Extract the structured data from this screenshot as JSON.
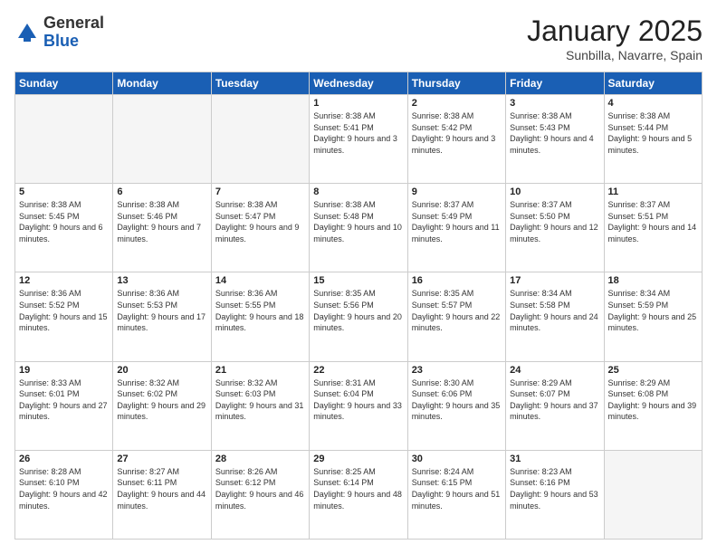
{
  "header": {
    "logo_general": "General",
    "logo_blue": "Blue",
    "title": "January 2025",
    "subtitle": "Sunbilla, Navarre, Spain"
  },
  "weekdays": [
    "Sunday",
    "Monday",
    "Tuesday",
    "Wednesday",
    "Thursday",
    "Friday",
    "Saturday"
  ],
  "weeks": [
    [
      {
        "day": "",
        "sunrise": "",
        "sunset": "",
        "daylight": ""
      },
      {
        "day": "",
        "sunrise": "",
        "sunset": "",
        "daylight": ""
      },
      {
        "day": "",
        "sunrise": "",
        "sunset": "",
        "daylight": ""
      },
      {
        "day": "1",
        "sunrise": "Sunrise: 8:38 AM",
        "sunset": "Sunset: 5:41 PM",
        "daylight": "Daylight: 9 hours and 3 minutes."
      },
      {
        "day": "2",
        "sunrise": "Sunrise: 8:38 AM",
        "sunset": "Sunset: 5:42 PM",
        "daylight": "Daylight: 9 hours and 3 minutes."
      },
      {
        "day": "3",
        "sunrise": "Sunrise: 8:38 AM",
        "sunset": "Sunset: 5:43 PM",
        "daylight": "Daylight: 9 hours and 4 minutes."
      },
      {
        "day": "4",
        "sunrise": "Sunrise: 8:38 AM",
        "sunset": "Sunset: 5:44 PM",
        "daylight": "Daylight: 9 hours and 5 minutes."
      }
    ],
    [
      {
        "day": "5",
        "sunrise": "Sunrise: 8:38 AM",
        "sunset": "Sunset: 5:45 PM",
        "daylight": "Daylight: 9 hours and 6 minutes."
      },
      {
        "day": "6",
        "sunrise": "Sunrise: 8:38 AM",
        "sunset": "Sunset: 5:46 PM",
        "daylight": "Daylight: 9 hours and 7 minutes."
      },
      {
        "day": "7",
        "sunrise": "Sunrise: 8:38 AM",
        "sunset": "Sunset: 5:47 PM",
        "daylight": "Daylight: 9 hours and 9 minutes."
      },
      {
        "day": "8",
        "sunrise": "Sunrise: 8:38 AM",
        "sunset": "Sunset: 5:48 PM",
        "daylight": "Daylight: 9 hours and 10 minutes."
      },
      {
        "day": "9",
        "sunrise": "Sunrise: 8:37 AM",
        "sunset": "Sunset: 5:49 PM",
        "daylight": "Daylight: 9 hours and 11 minutes."
      },
      {
        "day": "10",
        "sunrise": "Sunrise: 8:37 AM",
        "sunset": "Sunset: 5:50 PM",
        "daylight": "Daylight: 9 hours and 12 minutes."
      },
      {
        "day": "11",
        "sunrise": "Sunrise: 8:37 AM",
        "sunset": "Sunset: 5:51 PM",
        "daylight": "Daylight: 9 hours and 14 minutes."
      }
    ],
    [
      {
        "day": "12",
        "sunrise": "Sunrise: 8:36 AM",
        "sunset": "Sunset: 5:52 PM",
        "daylight": "Daylight: 9 hours and 15 minutes."
      },
      {
        "day": "13",
        "sunrise": "Sunrise: 8:36 AM",
        "sunset": "Sunset: 5:53 PM",
        "daylight": "Daylight: 9 hours and 17 minutes."
      },
      {
        "day": "14",
        "sunrise": "Sunrise: 8:36 AM",
        "sunset": "Sunset: 5:55 PM",
        "daylight": "Daylight: 9 hours and 18 minutes."
      },
      {
        "day": "15",
        "sunrise": "Sunrise: 8:35 AM",
        "sunset": "Sunset: 5:56 PM",
        "daylight": "Daylight: 9 hours and 20 minutes."
      },
      {
        "day": "16",
        "sunrise": "Sunrise: 8:35 AM",
        "sunset": "Sunset: 5:57 PM",
        "daylight": "Daylight: 9 hours and 22 minutes."
      },
      {
        "day": "17",
        "sunrise": "Sunrise: 8:34 AM",
        "sunset": "Sunset: 5:58 PM",
        "daylight": "Daylight: 9 hours and 24 minutes."
      },
      {
        "day": "18",
        "sunrise": "Sunrise: 8:34 AM",
        "sunset": "Sunset: 5:59 PM",
        "daylight": "Daylight: 9 hours and 25 minutes."
      }
    ],
    [
      {
        "day": "19",
        "sunrise": "Sunrise: 8:33 AM",
        "sunset": "Sunset: 6:01 PM",
        "daylight": "Daylight: 9 hours and 27 minutes."
      },
      {
        "day": "20",
        "sunrise": "Sunrise: 8:32 AM",
        "sunset": "Sunset: 6:02 PM",
        "daylight": "Daylight: 9 hours and 29 minutes."
      },
      {
        "day": "21",
        "sunrise": "Sunrise: 8:32 AM",
        "sunset": "Sunset: 6:03 PM",
        "daylight": "Daylight: 9 hours and 31 minutes."
      },
      {
        "day": "22",
        "sunrise": "Sunrise: 8:31 AM",
        "sunset": "Sunset: 6:04 PM",
        "daylight": "Daylight: 9 hours and 33 minutes."
      },
      {
        "day": "23",
        "sunrise": "Sunrise: 8:30 AM",
        "sunset": "Sunset: 6:06 PM",
        "daylight": "Daylight: 9 hours and 35 minutes."
      },
      {
        "day": "24",
        "sunrise": "Sunrise: 8:29 AM",
        "sunset": "Sunset: 6:07 PM",
        "daylight": "Daylight: 9 hours and 37 minutes."
      },
      {
        "day": "25",
        "sunrise": "Sunrise: 8:29 AM",
        "sunset": "Sunset: 6:08 PM",
        "daylight": "Daylight: 9 hours and 39 minutes."
      }
    ],
    [
      {
        "day": "26",
        "sunrise": "Sunrise: 8:28 AM",
        "sunset": "Sunset: 6:10 PM",
        "daylight": "Daylight: 9 hours and 42 minutes."
      },
      {
        "day": "27",
        "sunrise": "Sunrise: 8:27 AM",
        "sunset": "Sunset: 6:11 PM",
        "daylight": "Daylight: 9 hours and 44 minutes."
      },
      {
        "day": "28",
        "sunrise": "Sunrise: 8:26 AM",
        "sunset": "Sunset: 6:12 PM",
        "daylight": "Daylight: 9 hours and 46 minutes."
      },
      {
        "day": "29",
        "sunrise": "Sunrise: 8:25 AM",
        "sunset": "Sunset: 6:14 PM",
        "daylight": "Daylight: 9 hours and 48 minutes."
      },
      {
        "day": "30",
        "sunrise": "Sunrise: 8:24 AM",
        "sunset": "Sunset: 6:15 PM",
        "daylight": "Daylight: 9 hours and 51 minutes."
      },
      {
        "day": "31",
        "sunrise": "Sunrise: 8:23 AM",
        "sunset": "Sunset: 6:16 PM",
        "daylight": "Daylight: 9 hours and 53 minutes."
      },
      {
        "day": "",
        "sunrise": "",
        "sunset": "",
        "daylight": ""
      }
    ]
  ]
}
